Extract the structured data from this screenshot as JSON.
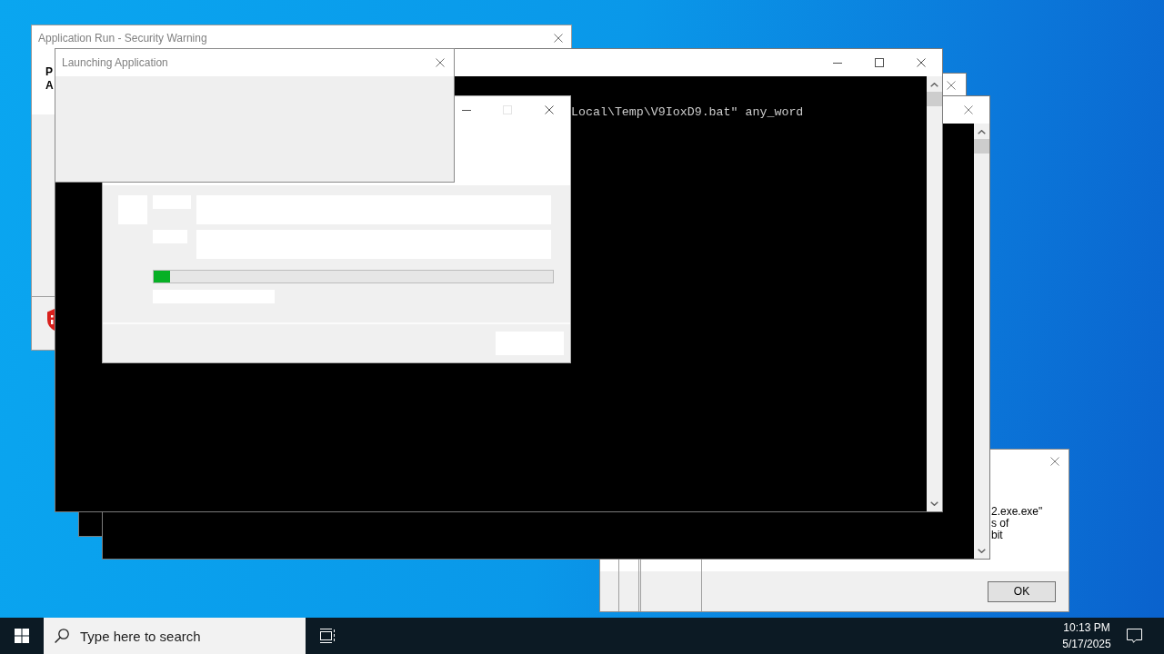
{
  "security_warning": {
    "title": "Application Run - Security Warning",
    "text_lines": [
      "P",
      "A"
    ]
  },
  "launching_dialog": {
    "title": "Launching Application"
  },
  "console": {
    "title_buttons": [
      {
        "kind": "minimize",
        "disabled": false
      },
      {
        "kind": "maximize",
        "disabled": false
      },
      {
        "kind": "close",
        "disabled": false
      }
    ],
    "lines": [
      "Local\\Temp\\V9IoxD9.bat\" any_word"
    ]
  },
  "progress_dialog": {
    "title_buttons": [
      {
        "kind": "minimize",
        "disabled": false
      },
      {
        "kind": "maximize",
        "disabled": true
      },
      {
        "kind": "close",
        "disabled": false
      }
    ],
    "progress": {
      "level": 0.04
    }
  },
  "message_dialog": {
    "text_lines": [
      "2.exe.exe\"",
      "s of",
      "bit"
    ],
    "ok_button": "OK"
  },
  "taskbar": {
    "search": {
      "placeholder": "Type here to search"
    },
    "clock": {
      "time": "10:13 PM",
      "date": "5/17/2025"
    }
  }
}
